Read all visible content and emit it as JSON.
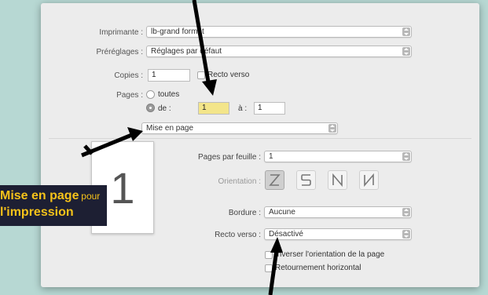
{
  "printer": {
    "label": "Imprimante :",
    "value": "lb-grand format"
  },
  "presets": {
    "label": "Préréglages :",
    "value": "Réglages par défaut"
  },
  "copies": {
    "label": "Copies :",
    "value": "1",
    "duplex_label": "Recto verso"
  },
  "pages": {
    "label": "Pages :",
    "option_all": "toutes",
    "option_from": "de :",
    "from_value": "1",
    "to_label": "à :",
    "to_value": "1"
  },
  "section_popup": {
    "value": "Mise en page"
  },
  "layout": {
    "pages_per_sheet_label": "Pages par feuille :",
    "pages_per_sheet_value": "1",
    "orientation_label": "Orientation :",
    "border_label": "Bordure :",
    "border_value": "Aucune",
    "duplex_label": "Recto verso :",
    "duplex_value": "Désactivé",
    "reverse_orientation": "Inverser l'orientation de la page",
    "flip_horizontal": "Retournement horizontal"
  },
  "preview": {
    "page_number": "1"
  },
  "callout": {
    "line1_bold": "Mise en page",
    "line1_small": "pour",
    "line2": "l'impression"
  },
  "colors": {
    "background": "#b7d8d3",
    "callout_bg": "#1d1f33",
    "callout_text": "#f6c21a",
    "highlight": "#f3e58a"
  },
  "icons": {
    "orientation": [
      "orientation-z-icon",
      "orientation-s-icon",
      "orientation-n-mirror-icon",
      "orientation-n-icon"
    ]
  }
}
